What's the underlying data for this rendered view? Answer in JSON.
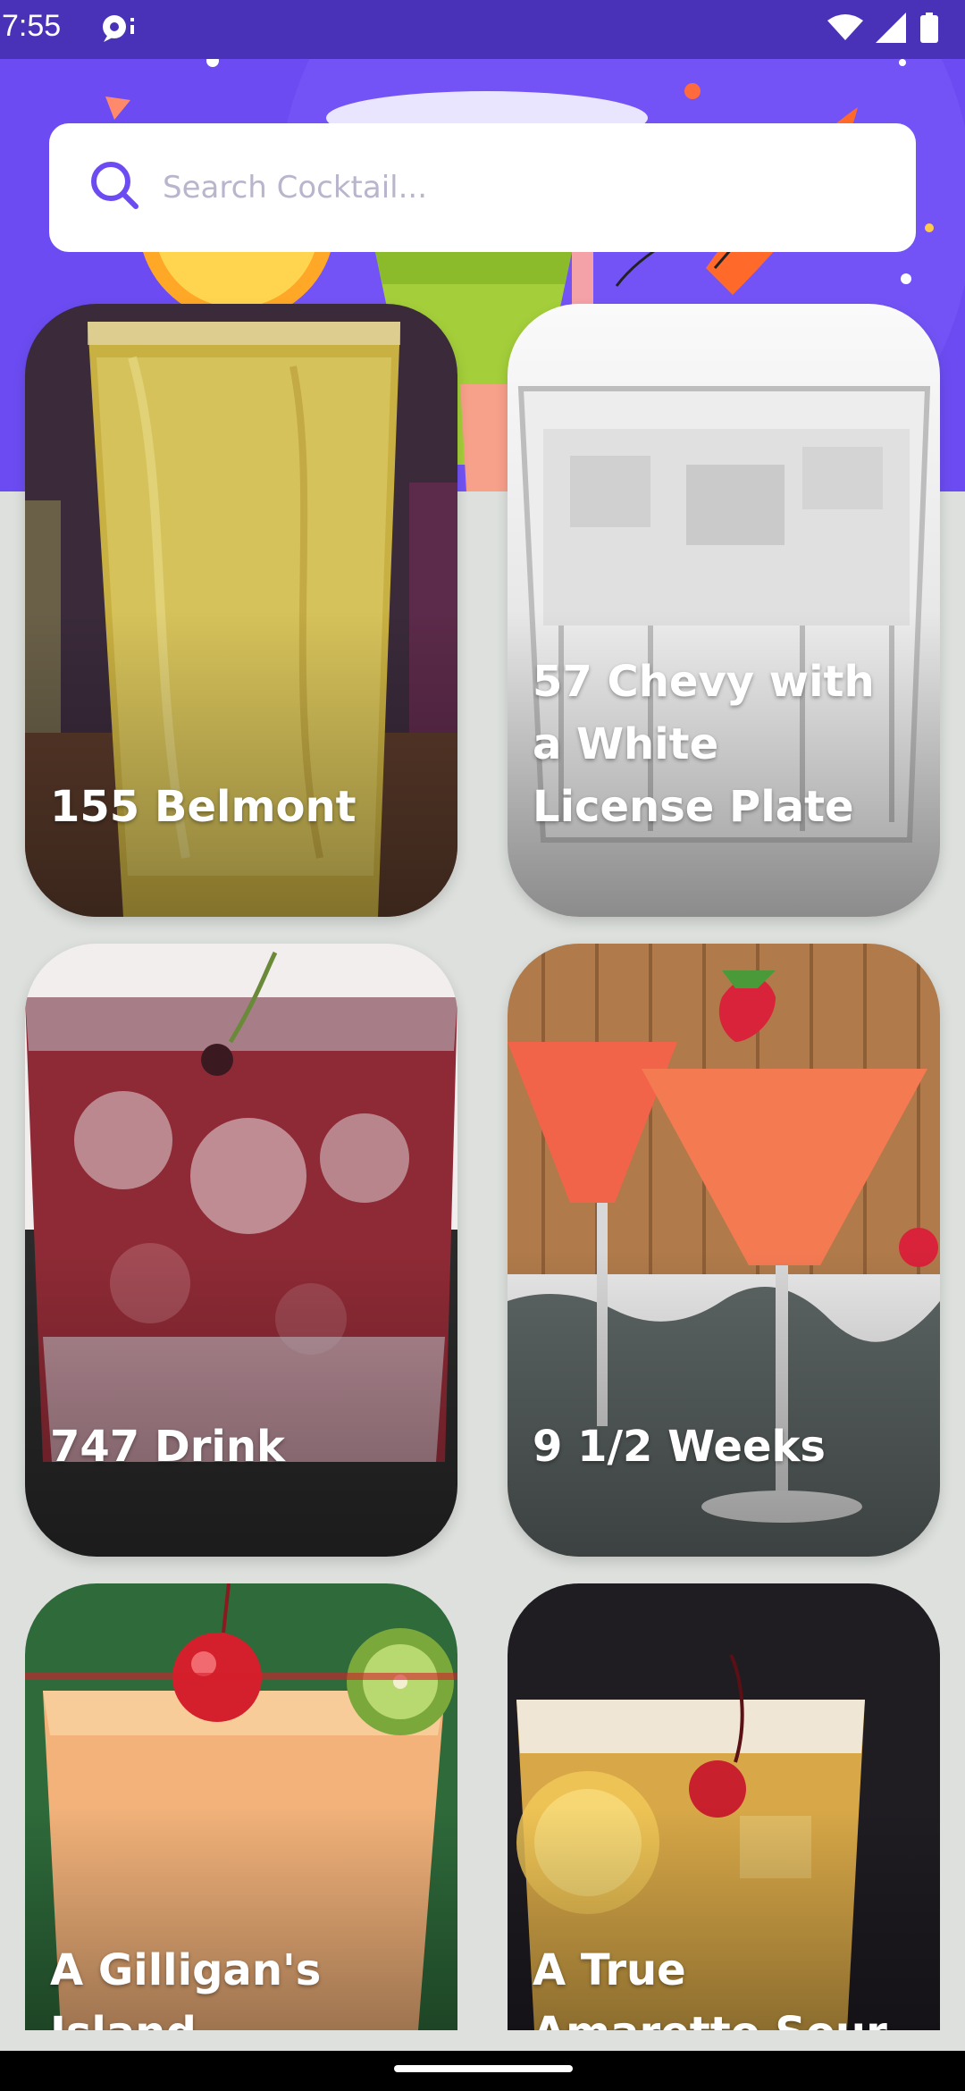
{
  "status": {
    "time": "7:55"
  },
  "search": {
    "placeholder": "Search Cocktail...",
    "value": ""
  },
  "colors": {
    "header": "#6C4CF2",
    "status_bar": "#4A32B8",
    "accent": "#6C4CF2",
    "background": "#DDE0DD"
  },
  "cocktails": [
    {
      "name": "155 Belmont"
    },
    {
      "name": "57 Chevy with a White License Plate"
    },
    {
      "name": "747 Drink"
    },
    {
      "name": "9 1/2 Weeks"
    },
    {
      "name": "A Gilligan's Island"
    },
    {
      "name": "A True Amaretto Sour"
    }
  ]
}
